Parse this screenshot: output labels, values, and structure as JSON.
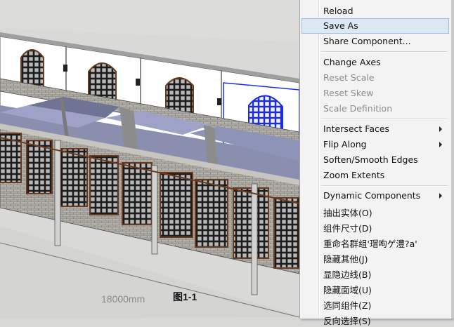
{
  "viewport": {
    "dimension_label": "18000mm",
    "figure_caption": "图1-1"
  },
  "context_menu": {
    "items": [
      {
        "label": "Reload",
        "enabled": true
      },
      {
        "label": "Save As",
        "enabled": true,
        "highlighted": true
      },
      {
        "label": "Share Component...",
        "enabled": true
      },
      {
        "label": "Change Axes",
        "enabled": true
      },
      {
        "label": "Reset Scale",
        "enabled": false
      },
      {
        "label": "Reset Skew",
        "enabled": false
      },
      {
        "label": "Scale Definition",
        "enabled": false
      },
      {
        "label": "Intersect Faces",
        "enabled": true,
        "submenu": true
      },
      {
        "label": "Flip Along",
        "enabled": true,
        "submenu": true
      },
      {
        "label": "Soften/Smooth Edges",
        "enabled": true
      },
      {
        "label": "Zoom Extents",
        "enabled": true
      },
      {
        "label": "Dynamic Components",
        "enabled": true,
        "submenu": true
      },
      {
        "label": "抽出实体(O)",
        "enabled": true
      },
      {
        "label": "组件尺寸(D)",
        "enabled": true
      },
      {
        "label": "重命名群组'瑁呴ゲ澧?a'",
        "enabled": true
      },
      {
        "label": "隐藏其他(J)",
        "enabled": true
      },
      {
        "label": "显隐边线(B)",
        "enabled": true
      },
      {
        "label": "隐藏面域(U)",
        "enabled": true
      },
      {
        "label": "选同组件(Z)",
        "enabled": true
      },
      {
        "label": "反向选择(S)",
        "enabled": true
      }
    ]
  },
  "colors": {
    "highlight": "#dde8f5",
    "selection_outline": "#1a2cf0",
    "window_frame": "#6b3a1c"
  }
}
